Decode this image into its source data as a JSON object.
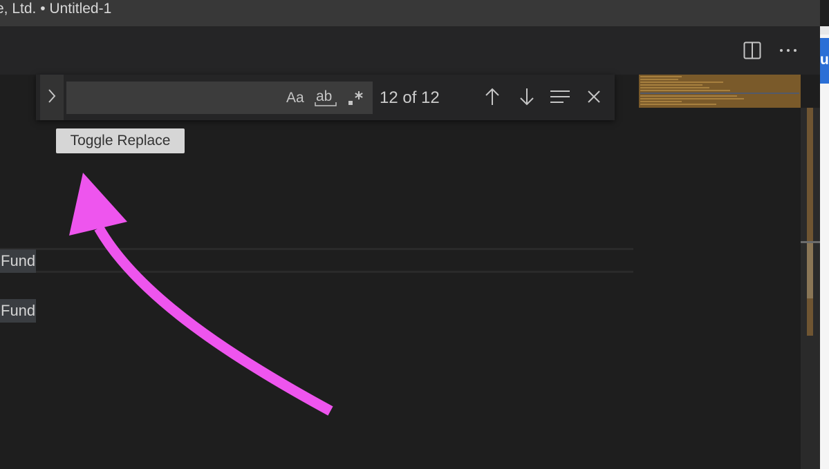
{
  "window": {
    "title": "e, Ltd. • Untitled-1"
  },
  "toolbar": {
    "split_editor_icon": "split-editor-icon",
    "more_actions_icon": "more-actions-icon"
  },
  "side_panel": {
    "visible_letter": "u"
  },
  "find_widget": {
    "search_value": "",
    "match_case_label": "Aa",
    "match_whole_word_label": "ab",
    "regex_label": ".*",
    "match_count": "12 of 12",
    "icons": {
      "toggle_replace": "chevron-right-icon",
      "previous": "arrow-up-icon",
      "next": "arrow-down-icon",
      "find_in_selection": "lines-icon",
      "close": "close-icon"
    }
  },
  "tooltip": {
    "text": "Toggle Replace"
  },
  "editor": {
    "lines": [
      "Fund",
      "Fund"
    ]
  },
  "annotation": {
    "color": "#ee55ee"
  },
  "colors": {
    "editor_bg": "#1e1e1e",
    "widget_bg": "#252526",
    "minimap_highlight": "#7a5a2a"
  }
}
